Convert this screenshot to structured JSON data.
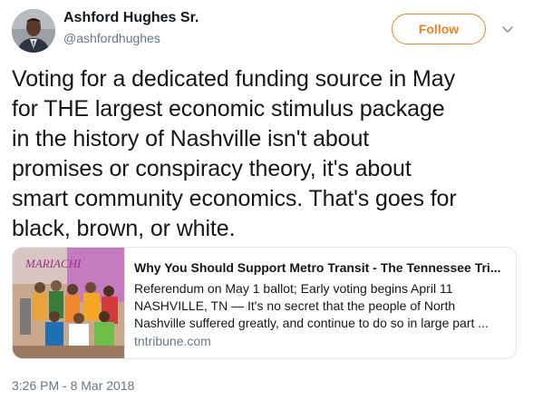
{
  "author": {
    "display_name": "Ashford Hughes Sr.",
    "handle": "@ashfordhughes",
    "avatar_icon": "avatar-photo"
  },
  "follow_label": "Follow",
  "menu_icon": "chevron-down-icon",
  "tweet_text": "Voting for a dedicated funding source in May\nfor THE largest economic stimulus package\nin the history of Nashville isn't about\npromises or conspiracy theory, it's about\nsmart community economics. That's goes for\nblack, brown, or white.",
  "card": {
    "title": "Why You Should Support Metro Transit - The Tennessee Tri...",
    "description_lines": [
      "Referendum on May 1 ballot; Early voting begins April 11",
      "NASHVILLE, TN — It's no secret that the people of North",
      "Nashville suffered greatly, and continue to do so in large part ..."
    ],
    "domain": "tntribune.com",
    "image_text": "MARIACHI"
  },
  "timestamp": "3:26 PM - 8 Mar 2018",
  "colors": {
    "accent": "#f4801f",
    "secondary_text": "#657786",
    "border": "#e1e8ed"
  }
}
